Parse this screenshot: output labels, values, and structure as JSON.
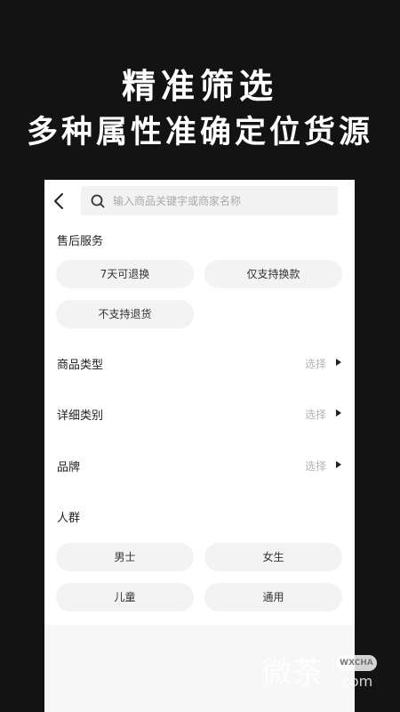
{
  "promo": {
    "title": "精准筛选",
    "subtitle": "多种属性准确定位货源"
  },
  "search": {
    "placeholder": "输入商品关键字或商家名称",
    "value": ""
  },
  "after_sales": {
    "title": "售后服务",
    "options": [
      "7天可退换",
      "仅支持换款",
      "不支持退货"
    ]
  },
  "filters": {
    "product_type": {
      "label": "商品类型",
      "value": "选择"
    },
    "detail_category": {
      "label": "详细类别",
      "value": "选择"
    },
    "brand": {
      "label": "品牌",
      "value": "选择"
    }
  },
  "audience": {
    "title": "人群",
    "options": [
      "男士",
      "女生",
      "儿童",
      "通用"
    ]
  },
  "watermark": {
    "glyphs": "微茶",
    "badge": "WXCHA",
    "suffix": ".com"
  },
  "icons": {
    "back": "chevron-left-icon",
    "search": "search-icon",
    "arrow": "chevron-right-icon"
  },
  "colors": {
    "page_bg": "#131313",
    "panel_bg": "#ffffff",
    "chip_bg": "#f3f3f3",
    "muted_text": "#b3b3b3"
  }
}
